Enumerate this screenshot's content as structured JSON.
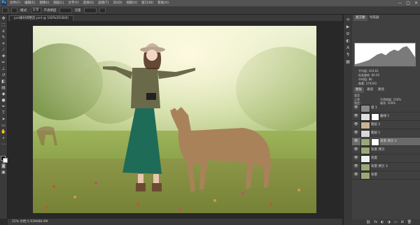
{
  "app": {
    "logo": "Ps"
  },
  "menubar": {
    "items": [
      "文件(F)",
      "编辑(E)",
      "图像(I)",
      "图层(L)",
      "文字(Y)",
      "选择(S)",
      "滤镜(T)",
      "3D(D)",
      "视图(V)",
      "窗口(W)",
      "帮助(H)"
    ],
    "window_controls": [
      "—",
      "□",
      "✕"
    ]
  },
  "options_bar": {
    "mode_label": "正常",
    "opacity_label": "不透明度",
    "flow_label": "流量"
  },
  "document": {
    "tab_title": "psd素材调整后.psd @ 100%(RGB/8)",
    "status_text": "25%   文档:5.93M/88.0M"
  },
  "panels": {
    "top_tabs": [
      "直方图",
      "导航器"
    ],
    "info_rows": [
      [
        "平均值:",
        "103.62"
      ],
      [
        "标准偏差:",
        "60.50"
      ],
      [
        "中间值:",
        "86"
      ],
      [
        "像素:",
        "379350"
      ]
    ],
    "layers_tabs": [
      "图层",
      "通道",
      "路径"
    ],
    "kind_filter": "类型",
    "blend_mode": "正常",
    "opacity_label": "不透明度: 100%",
    "fill_label": "填充: 100%",
    "lock_label": "锁定:"
  },
  "layers": [
    {
      "name": "组 1",
      "has_mask": false,
      "thumb_color": "#8a8a8a",
      "visible": true,
      "selected": false
    },
    {
      "name": "曲线 1",
      "has_mask": true,
      "thumb_color": "#e0e0e0",
      "visible": true,
      "selected": false
    },
    {
      "name": "图层 2",
      "has_mask": false,
      "thumb_color": "#c9b48c",
      "visible": true,
      "selected": false
    },
    {
      "name": "图层 1",
      "has_mask": false,
      "thumb_color": "#d8d8d8",
      "visible": true,
      "selected": false
    },
    {
      "name": "背景 拷贝 2",
      "has_mask": true,
      "thumb_color": "#9aa877",
      "visible": true,
      "selected": true
    },
    {
      "name": "背景 拷贝",
      "has_mask": false,
      "thumb_color": "#9aa877",
      "visible": true,
      "selected": false
    },
    {
      "name": "亮度",
      "has_mask": false,
      "thumb_color": "#f0f0f0",
      "visible": true,
      "selected": false
    },
    {
      "name": "背景 拷贝 3",
      "has_mask": false,
      "thumb_color": "#9aa877",
      "visible": true,
      "selected": false
    },
    {
      "name": "背景",
      "has_mask": false,
      "thumb_color": "#9aa877",
      "visible": true,
      "selected": false
    }
  ],
  "icons": {
    "eye": "👁",
    "layer_bottom": [
      "⛓",
      "fx",
      "◐",
      "◑",
      "▭",
      "⊞",
      "🗑"
    ]
  }
}
